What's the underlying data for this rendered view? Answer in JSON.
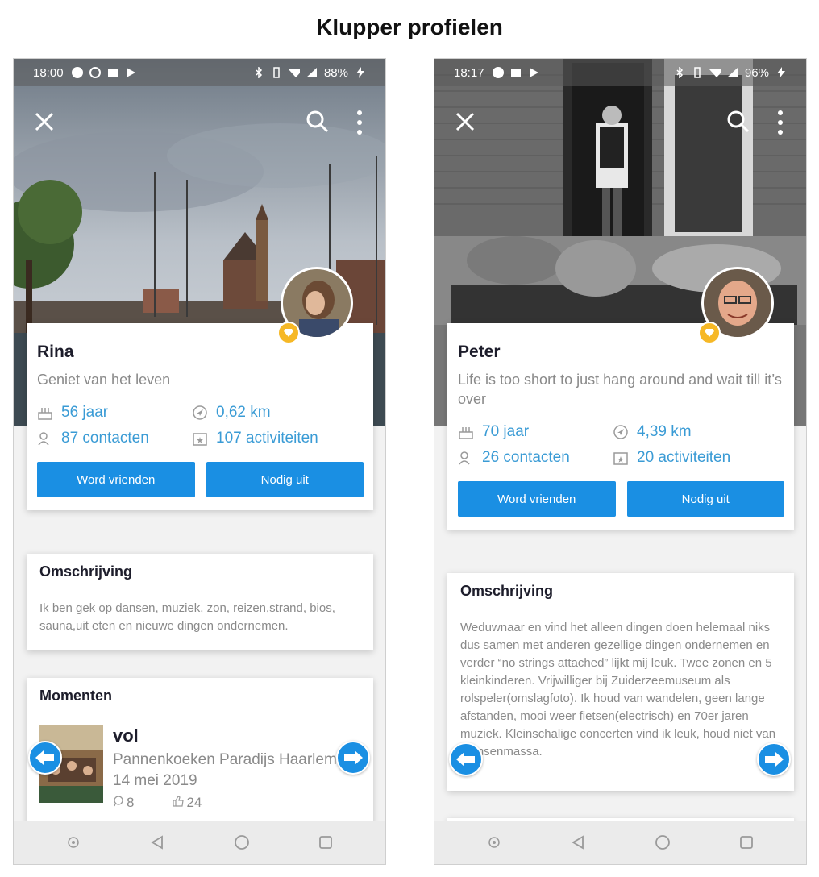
{
  "page_title": "Klupper profielen",
  "colors": {
    "accent": "#1a8fe3",
    "stat_blue": "#3a9bd5",
    "badge_gold": "#f6b826"
  },
  "left": {
    "status": {
      "time": "18:00",
      "battery": "88%"
    },
    "profile": {
      "name": "Rina",
      "tagline": "Geniet van het leven",
      "age": "56 jaar",
      "distance": "0,62 km",
      "contacts": "87 contacten",
      "activities": "107 activiteiten"
    },
    "buttons": {
      "befriend": "Word vrienden",
      "invite": "Nodig uit"
    },
    "description": {
      "title": "Omschrijving",
      "text": "Ik ben gek op dansen, muziek, zon, reizen,strand, bios, sauna,uit eten en nieuwe dingen ondernemen."
    },
    "moments": {
      "title": "Momenten",
      "item_title": "vol",
      "item_place": "Pannenkoeken Paradijs Haarlem",
      "item_date": "14 mei 2019",
      "comments": "8",
      "likes": "24"
    }
  },
  "right": {
    "status": {
      "time": "18:17",
      "battery": "96%"
    },
    "profile": {
      "name": "Peter",
      "tagline": "Life is too short to just hang around and wait till it’s over",
      "age": "70 jaar",
      "distance": "4,39 km",
      "contacts": "26 contacten",
      "activities": "20 activiteiten"
    },
    "buttons": {
      "befriend": "Word vrienden",
      "invite": "Nodig uit"
    },
    "description": {
      "title": "Omschrijving",
      "text": "Weduwnaar en vind het alleen dingen doen helemaal niks dus samen met anderen gezellige dingen ondernemen en verder “no strings attached” lijkt mij leuk. Twee zonen en 5 kleinkinderen. Vrijwilliger bij Zuiderzeemuseum als rolspeler(omslagfoto). Ik houd van wandelen, geen lange afstanden, mooi weer fietsen(electrisch) en 70er jaren muziek. Kleinschalige concerten vind ik leuk, houd niet van mensenmassa."
    }
  }
}
